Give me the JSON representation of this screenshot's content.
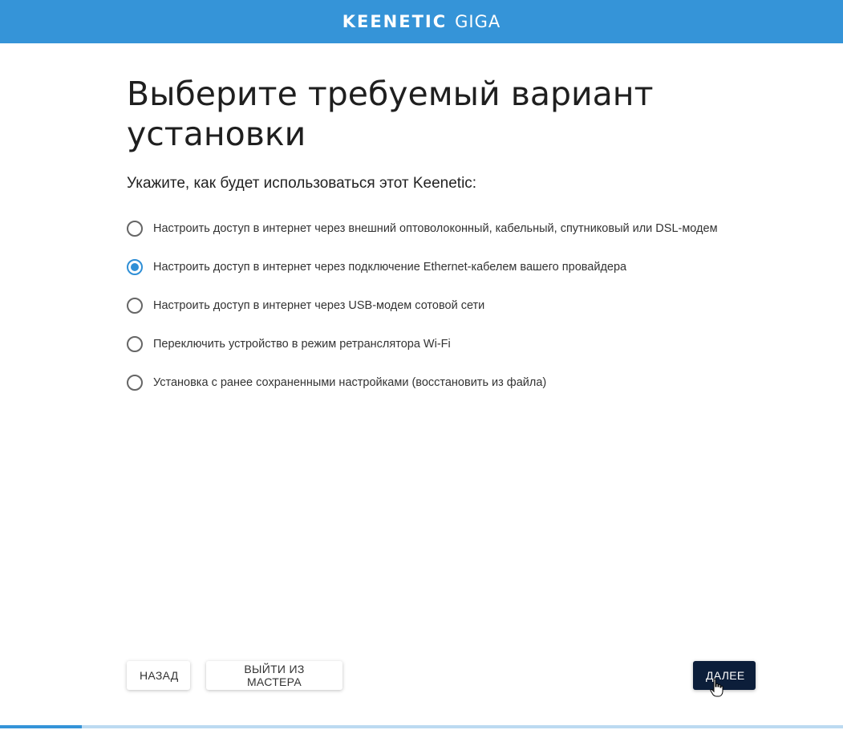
{
  "header": {
    "brand_name": "KEENETIC",
    "brand_model": "GIGA",
    "color": "#3594d8"
  },
  "page": {
    "title": "Выберите требуемый вариант установки",
    "subtitle": "Укажите, как будет использоваться этот Keenetic:"
  },
  "options": [
    {
      "label": "Настроить доступ в интернет через внешний оптоволоконный, кабельный, спутниковый или DSL-модем",
      "selected": false
    },
    {
      "label": "Настроить доступ в интернет через подключение Ethernet-кабелем вашего провайдера",
      "selected": true
    },
    {
      "label": "Настроить доступ в интернет через USB-модем сотовой сети",
      "selected": false
    },
    {
      "label": "Переключить устройство в режим ретранслятора Wi-Fi",
      "selected": false
    },
    {
      "label": "Установка с ранее сохраненными настройками (восстановить из файла)",
      "selected": false
    }
  ],
  "buttons": {
    "back": "НАЗАД",
    "exit": "ВЫЙТИ ИЗ МАСТЕРА",
    "next": "ДАЛЕЕ"
  },
  "progress": {
    "fraction": 0.097
  },
  "icons": {
    "cursor": "hand-pointer-icon"
  }
}
